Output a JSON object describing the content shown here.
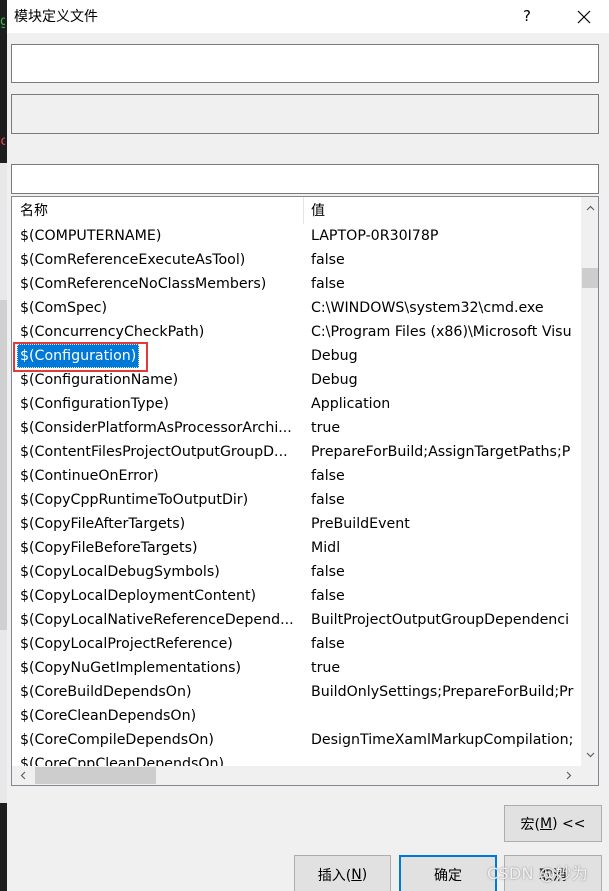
{
  "dialog": {
    "title": "模块定义文件",
    "help_label": "?",
    "close_icon": "close-icon"
  },
  "fields": {
    "definition_value": "",
    "evaluated_value": "",
    "filter_value": ""
  },
  "macro_list": {
    "columns": {
      "name": "名称",
      "value": "值"
    },
    "selected_index": 5,
    "rows": [
      {
        "name": "$(COMPUTERNAME)",
        "value": "LAPTOP-0R30I78P"
      },
      {
        "name": "$(ComReferenceExecuteAsTool)",
        "value": "false"
      },
      {
        "name": "$(ComReferenceNoClassMembers)",
        "value": "false"
      },
      {
        "name": "$(ComSpec)",
        "value": "C:\\WINDOWS\\system32\\cmd.exe"
      },
      {
        "name": "$(ConcurrencyCheckPath)",
        "value": "C:\\Program Files (x86)\\Microsoft Visu"
      },
      {
        "name": "$(Configuration)",
        "value": "Debug"
      },
      {
        "name": "$(ConfigurationName)",
        "value": "Debug"
      },
      {
        "name": "$(ConfigurationType)",
        "value": "Application"
      },
      {
        "name": "$(ConsiderPlatformAsProcessorArchi...",
        "value": "true"
      },
      {
        "name": "$(ContentFilesProjectOutputGroupD...",
        "value": "PrepareForBuild;AssignTargetPaths;P"
      },
      {
        "name": "$(ContinueOnError)",
        "value": "false"
      },
      {
        "name": "$(CopyCppRuntimeToOutputDir)",
        "value": "false"
      },
      {
        "name": "$(CopyFileAfterTargets)",
        "value": "PreBuildEvent"
      },
      {
        "name": "$(CopyFileBeforeTargets)",
        "value": "Midl"
      },
      {
        "name": "$(CopyLocalDebugSymbols)",
        "value": "false"
      },
      {
        "name": "$(CopyLocalDeploymentContent)",
        "value": "false"
      },
      {
        "name": "$(CopyLocalNativeReferenceDepend...",
        "value": "BuiltProjectOutputGroupDependenci"
      },
      {
        "name": "$(CopyLocalProjectReference)",
        "value": "false"
      },
      {
        "name": "$(CopyNuGetImplementations)",
        "value": "true"
      },
      {
        "name": "$(CoreBuildDependsOn)",
        "value": "BuildOnlySettings;PrepareForBuild;Pr"
      },
      {
        "name": "$(CoreCleanDependsOn)",
        "value": ""
      },
      {
        "name": "$(CoreCompileDependsOn)",
        "value": "DesignTimeXamlMarkupCompilation;"
      },
      {
        "name": "$(CoreCppCleanDependsOn)",
        "value": ""
      }
    ]
  },
  "buttons": {
    "macros": {
      "prefix": "宏(",
      "accel": "M",
      "suffix": ") <<"
    },
    "insert": {
      "prefix": "插入(",
      "accel": "N",
      "suffix": ")"
    },
    "ok": "确定",
    "cancel": "取消"
  },
  "watermark": "CSDN @妙为",
  "colors": {
    "selection": "#0078d7",
    "annotation": "#e03a3a",
    "default_button_border": "#0078d7"
  }
}
